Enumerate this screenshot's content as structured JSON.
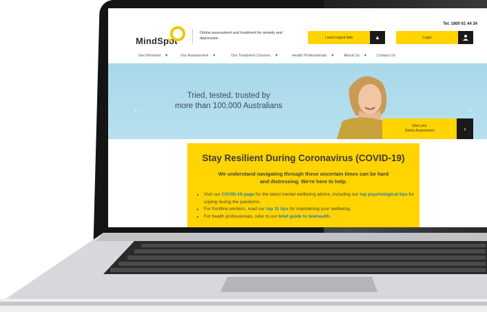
{
  "header": {
    "logo_text": "MindSpot",
    "tagline": "Online assessment and treatment for anxiety and depression",
    "tel": "Tel. 1800 61 44 34",
    "urgent_help_label": "I need urgent help",
    "login_label": "Login",
    "user_icon": "user-icon"
  },
  "nav": {
    "items": [
      {
        "label": "Get Informed"
      },
      {
        "label": "Our Assessment"
      },
      {
        "label": "Our Treatment Courses"
      },
      {
        "label": "Health Professionals"
      },
      {
        "label": "About Us"
      },
      {
        "label": "Contact Us"
      }
    ]
  },
  "hero": {
    "headline_line1": "Tried, tested, trusted by",
    "headline_line2": "more than 100,000 Australians",
    "cta_line1": "Start your",
    "cta_line2": "Online Assessment",
    "cta_arrow": "›",
    "prev_chevron": "‹",
    "next_chevron": "›"
  },
  "covid": {
    "title": "Stay Resilient During Coronavirus (COVID-19)",
    "subtitle": "We understand navigating through these uncertain times can be hard and distressing. We're here to help.",
    "bullets": [
      {
        "pre": "Visit our ",
        "link": "COVID-19 page",
        "mid": " for the latest mental wellbeing advice, including our ",
        "link2": "top psychological tips",
        "post": " for coping during the pandemic."
      },
      {
        "pre": "For frontline workers, read our ",
        "link": "top 11 tips",
        "mid": " for maintaining your wellbeing.",
        "link2": "",
        "post": ""
      },
      {
        "pre": "For health professionals, refer to our ",
        "link": "brief guide to telehealth",
        "mid": ".",
        "link2": "",
        "post": ""
      }
    ]
  },
  "colors": {
    "accent_yellow": "#ffd400",
    "hero_blue": "#a9d8ea",
    "link_blue": "#1b7fb6",
    "dark_button": "#1a1a1a"
  }
}
